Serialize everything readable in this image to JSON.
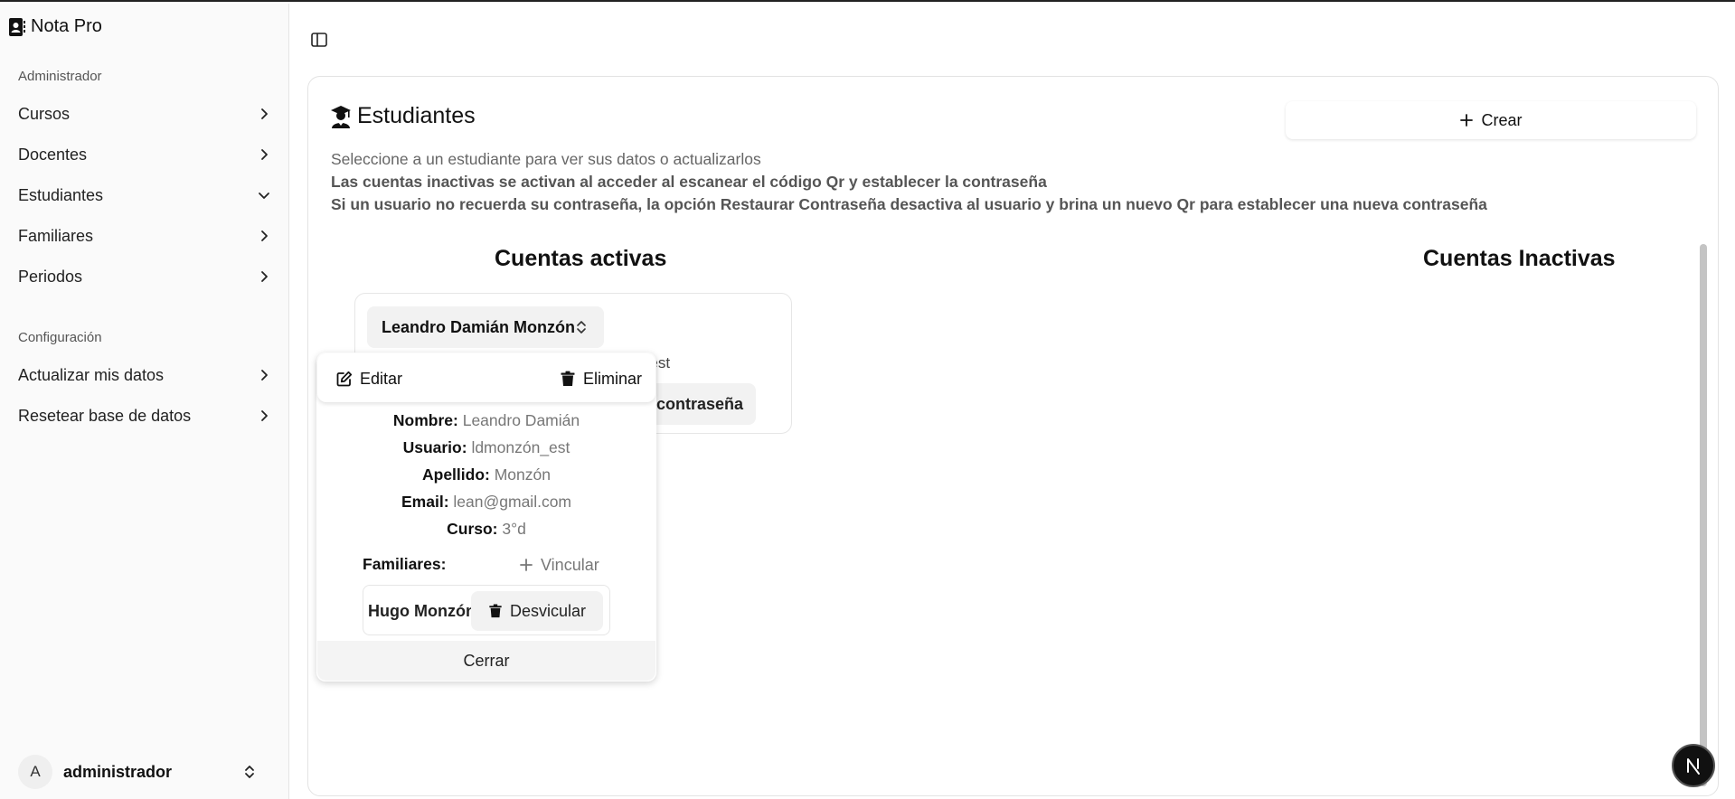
{
  "app": {
    "title": "Nota Pro"
  },
  "sidebar": {
    "admin_label": "Administrador",
    "admin_items": [
      {
        "label": "Cursos",
        "icon": "chevron-right-icon"
      },
      {
        "label": "Docentes",
        "icon": "chevron-right-icon"
      },
      {
        "label": "Estudiantes",
        "icon": "chevron-down-icon"
      },
      {
        "label": "Familiares",
        "icon": "chevron-right-icon"
      },
      {
        "label": "Periodos",
        "icon": "chevron-right-icon"
      }
    ],
    "config_label": "Configuración",
    "config_items": [
      {
        "label": "Actualizar mis datos",
        "icon": "chevron-right-icon"
      },
      {
        "label": "Resetear base de datos",
        "icon": "chevron-right-icon"
      }
    ],
    "user": {
      "initial": "A",
      "name": "administrador"
    }
  },
  "main": {
    "title": "Estudiantes",
    "create_label": "Crear",
    "descriptions": [
      "Seleccione a un estudiante para ver sus datos o actualizarlos",
      "Las cuentas inactivas se activan al acceder al escanear el código Qr y establecer la contraseña",
      "Si un usuario no recuerda su contraseña, la opción Restaurar Contraseña desactiva al usuario y brina un nuevo Qr para establecer una nueva contraseña"
    ],
    "active_title": "Cuentas activas",
    "inactive_title": "Cuentas Inactivas",
    "student": {
      "select_label": "Leandro Damián Monzón",
      "partial_user": "ón_est",
      "partial_reset": "contraseña"
    },
    "popover": {
      "edit_label": "Editar",
      "delete_label": "Eliminar",
      "fields": [
        {
          "key": "Nombre:",
          "value": "Leandro Damián"
        },
        {
          "key": "Usuario:",
          "value": "ldmonzón_est"
        },
        {
          "key": "Apellido:",
          "value": "Monzón"
        },
        {
          "key": "Email:",
          "value": "lean@gmail.com"
        },
        {
          "key": "Curso:",
          "value": "3°d"
        }
      ],
      "family_label": "Familiares:",
      "link_label": "Vincular",
      "family_member": "Hugo Monzón",
      "unlink_label": "Desvicular",
      "close_label": "Cerrar"
    }
  },
  "badge": {
    "letter": "N"
  }
}
